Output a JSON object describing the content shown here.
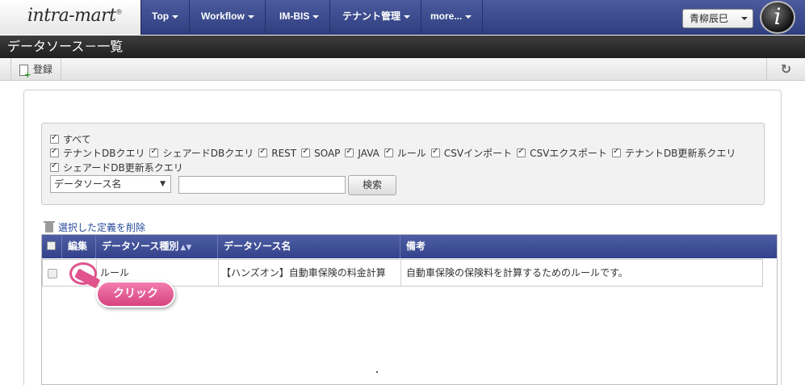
{
  "brand": {
    "logo_text": "intra-mart",
    "logo_mark": "®"
  },
  "nav": {
    "items": [
      {
        "label": "Top"
      },
      {
        "label": "Workflow"
      },
      {
        "label": "IM-BIS"
      },
      {
        "label": "テナント管理"
      },
      {
        "label": "more..."
      }
    ],
    "user_name": "青柳辰巳",
    "avatar_letter": "i"
  },
  "page": {
    "title": "データソース－一覧"
  },
  "toolbar": {
    "register_label": "登録",
    "refresh_icon": "refresh-icon"
  },
  "filter": {
    "all_label": "すべて",
    "types": [
      {
        "label": "テナントDBクエリ",
        "checked": true
      },
      {
        "label": "シェアードDBクエリ",
        "checked": true
      },
      {
        "label": "REST",
        "checked": true
      },
      {
        "label": "SOAP",
        "checked": true
      },
      {
        "label": "JAVA",
        "checked": true
      },
      {
        "label": "ルール",
        "checked": true
      },
      {
        "label": "CSVインポート",
        "checked": true
      },
      {
        "label": "CSVエクスポート",
        "checked": true
      },
      {
        "label": "テナントDB更新系クエリ",
        "checked": true
      }
    ],
    "types_row2": [
      {
        "label": "シェアードDB更新系クエリ",
        "checked": true
      }
    ],
    "field_select": "データソース名",
    "search_value": "",
    "search_button": "検索"
  },
  "actions": {
    "delete_selected": "選択した定義を削除"
  },
  "table": {
    "headers": {
      "edit": "編集",
      "type": "データソース種別",
      "name": "データソース名",
      "note": "備考"
    },
    "sort_icon": "sort-icon",
    "rows": [
      {
        "type": "ルール",
        "name": "【ハンズオン】自動車保険の料金計算",
        "note": "自動車保険の保険料を計算するためのルールです。"
      }
    ]
  },
  "callout": {
    "label": "クリック"
  },
  "colors": {
    "header_blue": "#3d4c94",
    "callout_pink": "#e0538c",
    "title_bar": "#2a2a2a"
  }
}
